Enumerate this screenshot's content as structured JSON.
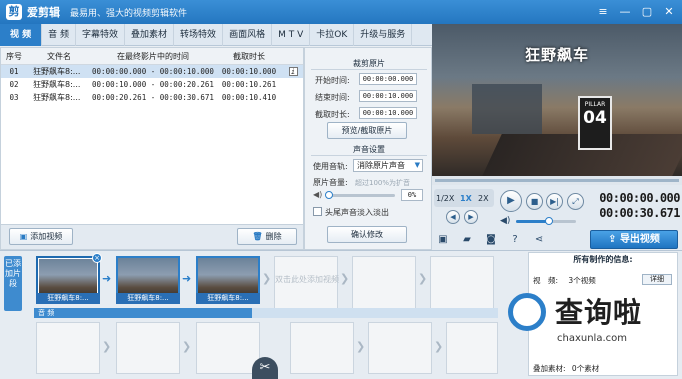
{
  "app": {
    "title": "爱剪辑",
    "slogan": "最易用、强大的视频剪辑软件",
    "logo_glyph": "剪"
  },
  "window_controls": [
    "≡",
    "—",
    "▢",
    "✕"
  ],
  "tabs": [
    {
      "label": "视 频",
      "active": true
    },
    {
      "label": "音 频"
    },
    {
      "label": "字幕特效"
    },
    {
      "label": "叠加素材"
    },
    {
      "label": "转场特效"
    },
    {
      "label": "画面风格"
    },
    {
      "label": "M T V"
    },
    {
      "label": "卡拉OK"
    },
    {
      "label": "升级与服务"
    }
  ],
  "clip_list": {
    "headers": [
      "序号",
      "文件名",
      "在最终影片中的时间",
      "截取时长"
    ],
    "rows": [
      {
        "index": "01",
        "name": "狂野飙车8:...",
        "time": "00:00:00.000 - 00:00:10.000",
        "duration": "00:00:10.000",
        "info": "i"
      },
      {
        "index": "02",
        "name": "狂野飙车8:...",
        "time": "00:00:10.000 - 00:00:20.261",
        "duration": "00:00:10.261"
      },
      {
        "index": "03",
        "name": "狂野飙车8:...",
        "time": "00:00:20.261 - 00:00:30.671",
        "duration": "00:00:10.410"
      }
    ],
    "add_button": "添加视频",
    "delete_button": "删除"
  },
  "trim_panel": {
    "section_title": "裁剪原片",
    "start_label": "开始时间:",
    "start_value": "00:00:00.000",
    "end_label": "结束时间:",
    "end_value": "00:00:10.000",
    "duration_label": "截取时长:",
    "duration_value": "00:00:10.000",
    "preview_button": "预览/截取原片",
    "audio_section": "声音设置",
    "track_label": "使用音轨:",
    "track_value": "消除原片声音",
    "volume_label": "原片音量:",
    "volume_hint": "超过100%为扩音",
    "volume_value": "0%",
    "volume_level": 0.0,
    "fade_label": "头尾声音淡入淡出",
    "confirm_button": "确认修改"
  },
  "preview": {
    "title": "狂野飙车",
    "sign_small": "PILLAR",
    "sign_big": "04",
    "progress": 0.0
  },
  "playback": {
    "speeds": [
      "1/2X",
      "1X",
      "2X"
    ],
    "active_speed": "1X",
    "current_time": "00:00:00.000",
    "total_time": "00:00:30.671",
    "volume_level": 0.55
  },
  "toolbar": {
    "icons": [
      "screenshot-icon",
      "folder-icon",
      "save-icon",
      "help-icon",
      "share-icon"
    ],
    "export_button": "导出视频"
  },
  "timeline": {
    "side_label": "已添加片段",
    "clips": [
      {
        "caption": "狂野飙车8:...",
        "selected": true
      },
      {
        "caption": "狂野飙车8:..."
      },
      {
        "caption": "狂野飙车8:..."
      }
    ],
    "empty_slot_text": "双击此处添加视频",
    "audio_label": "音 频"
  },
  "info_box": {
    "title": "所有制作的信息:",
    "rows": [
      {
        "label": "视　频:",
        "value": "3个视频"
      },
      {
        "label": "叠加素材:",
        "value": "0个素材"
      }
    ],
    "detail_button": "详细"
  },
  "watermark": {
    "text": "查询啦",
    "url": "chaxunla.com"
  },
  "colors": {
    "accent": "#2c7fc9",
    "titlebar": "#2476c0"
  }
}
